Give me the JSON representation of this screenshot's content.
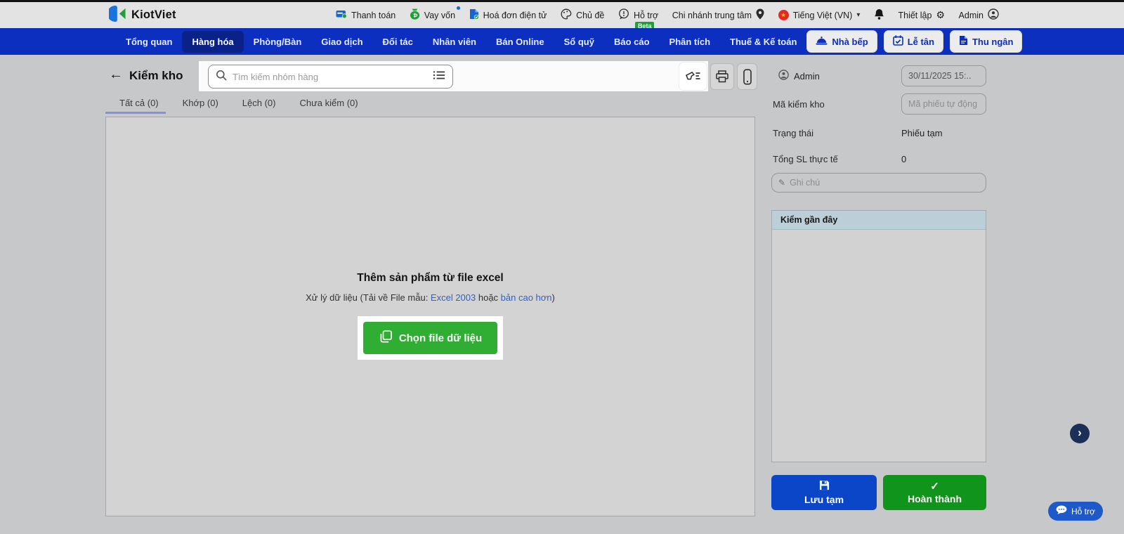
{
  "icons": {
    "back": "←",
    "caret": "▾",
    "gear": "⚙",
    "star": "★",
    "pencil": "✎",
    "check": "✓",
    "chevron": "›"
  },
  "topbar": {
    "brand": "KiotViet",
    "items": [
      {
        "label": "Thanh toán",
        "icon": "payment-icon"
      },
      {
        "label": "Vay vốn",
        "icon": "loan-icon"
      },
      {
        "label": "Hoá đơn điện tử",
        "icon": "e-invoice-icon"
      },
      {
        "label": "Chủ đề",
        "icon": "theme-icon"
      },
      {
        "label": "Hỗ trợ",
        "icon": "support-icon",
        "badge": "Beta"
      },
      {
        "label": "Chi nhánh trung tâm",
        "icon": "location-icon"
      }
    ],
    "language": "Tiếng Việt (VN)",
    "settings": "Thiết lập",
    "user": "Admin"
  },
  "nav": {
    "items": [
      "Tổng quan",
      "Hàng hóa",
      "Phòng/Bàn",
      "Giao dịch",
      "Đối tác",
      "Nhân viên",
      "Bán Online",
      "Sổ quỹ",
      "Báo cáo",
      "Phân tích",
      "Thuế & Kế toán"
    ],
    "active": "Hàng hóa",
    "modes": [
      {
        "label": "Nhà bếp",
        "icon": "kitchen-icon"
      },
      {
        "label": "Lễ tân",
        "icon": "reception-icon"
      },
      {
        "label": "Thu ngân",
        "icon": "cashier-icon"
      }
    ]
  },
  "header": {
    "title": "Kiểm kho",
    "search_placeholder": "Tìm kiếm nhóm hàng"
  },
  "tabs": [
    {
      "label": "Tất cả (0)",
      "active": true
    },
    {
      "label": "Khớp (0)",
      "active": false
    },
    {
      "label": "Lệch (0)",
      "active": false
    },
    {
      "label": "Chưa kiểm (0)",
      "active": false
    }
  ],
  "empty_state": {
    "title": "Thêm sản phẩm từ file excel",
    "desc_prefix": "Xử lý dữ liệu (Tải về File mẫu: ",
    "link_excel": "Excel 2003",
    "desc_middle": " hoặc ",
    "link_newer": "bản cao hơn",
    "desc_suffix": ")",
    "choose_file_button": "Chọn file dữ liệu"
  },
  "sidebar": {
    "user": "Admin",
    "datetime": "30/11/2025 15:..",
    "code_label": "Mã kiểm kho",
    "code_placeholder": "Mã phiếu tự động",
    "status_label": "Trạng thái",
    "status_value": "Phiếu tạm",
    "total_label": "Tổng SL thực tế",
    "total_value": "0",
    "note_placeholder": "Ghi chú",
    "recent_title": "Kiểm gần đây",
    "save_draft": "Lưu tạm",
    "complete": "Hoàn thành"
  },
  "floating": {
    "support": "Hỗ trợ"
  },
  "colors": {
    "nav_blue": "#0c2fc0",
    "active_nav": "#0a2287",
    "choose_green": "#2fae33",
    "complete_green": "#11941c",
    "save_blue": "#0b46c9",
    "tab_underline": "#8592da",
    "beta_green": "#21a038"
  }
}
